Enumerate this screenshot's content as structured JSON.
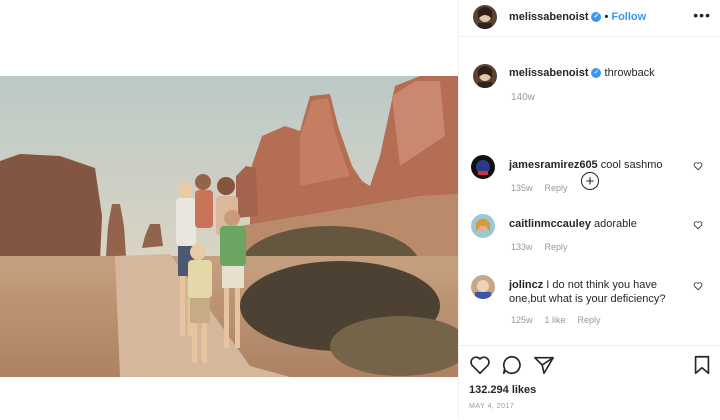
{
  "post": {
    "username": "melissabenoist",
    "follow_label": "Follow",
    "more_label": "•••",
    "caption_text": "throwback",
    "caption_time": "140w",
    "load_more_label": "+",
    "likes": "132.294 likes",
    "date": "MAY 4, 2017"
  },
  "comments": [
    {
      "username": "jamesramirez605",
      "text": "cool sashmo",
      "time": "135w",
      "likes": "",
      "reply": "Reply"
    },
    {
      "username": "caitlinmccauley",
      "text": "adorable",
      "time": "133w",
      "likes": "",
      "reply": "Reply"
    },
    {
      "username": "jolincz",
      "text": "I do not think you have one,but what is your deficiency?",
      "time": "125w",
      "likes": "1 like",
      "reply": "Reply"
    }
  ],
  "icons": [
    "heart-icon",
    "comment-icon",
    "share-icon",
    "bookmark-icon",
    "verified-badge-icon",
    "plus-circle-icon"
  ],
  "colors": {
    "link_blue": "#3897f0",
    "verified_blue": "#3897f0",
    "muted_gray": "#999999"
  }
}
